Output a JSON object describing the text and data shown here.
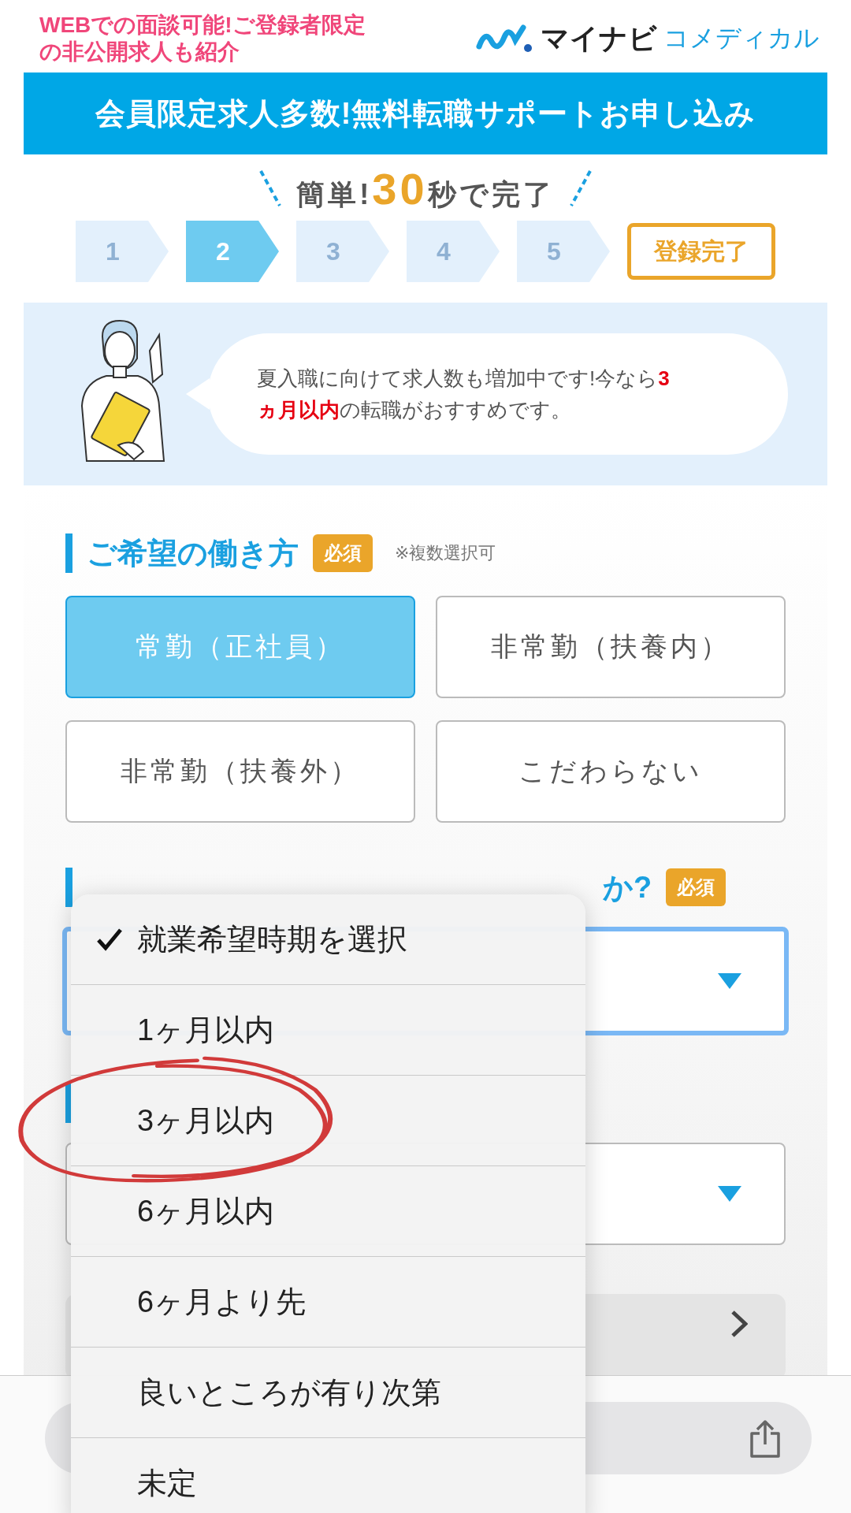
{
  "header": {
    "tagline_lines": [
      "WEBでの面談可能!ご登録者限定",
      "の非公開求人も紹介"
    ],
    "logo_main": "マイナビ",
    "logo_sub": "コメディカル"
  },
  "banner": "会員限定求人多数!無料転職サポートお申し込み",
  "speed_note": "簡単!**30**秒で完了",
  "steps": [
    {
      "label": "1",
      "kind": "step",
      "selected": false
    },
    {
      "label": "2",
      "kind": "step",
      "selected": true
    },
    {
      "label": "3",
      "kind": "step",
      "selected": false
    },
    {
      "label": "4",
      "kind": "step",
      "selected": false
    },
    {
      "label": "5",
      "kind": "step",
      "selected": false
    },
    {
      "label": "登録完了",
      "kind": "goal",
      "selected": false
    }
  ],
  "message_lines": [
    "夏入職に向けて求人数も増加中です!今なら**3**",
    "**ヵ月以内**の転職がおすすめです。"
  ],
  "work_style": {
    "title": "ご希望の働き方",
    "required": "必須",
    "note": "※複数選択可",
    "options": [
      {
        "label": "常勤（正社員）",
        "selected": true
      },
      {
        "label": "非常勤（扶養内）",
        "selected": false
      },
      {
        "label": "非常勤（扶養外）",
        "selected": false
      },
      {
        "label": "こだわらない",
        "selected": false
      }
    ]
  },
  "timing": {
    "title_visible": "か?",
    "required": "必須",
    "select": {
      "focused": true
    }
  },
  "next_section": {
    "select": {
      "focused": false
    }
  },
  "picker": {
    "items": [
      {
        "label": "就業希望時期を選択",
        "selected": true,
        "circled": false
      },
      {
        "label": "1ヶ月以内",
        "selected": false,
        "circled": false
      },
      {
        "label": "3ヶ月以内",
        "selected": false,
        "circled": true
      },
      {
        "label": "6ヶ月以内",
        "selected": false,
        "circled": false
      },
      {
        "label": "6ヶ月より先",
        "selected": false,
        "circled": false
      },
      {
        "label": "良いところが有り次第",
        "selected": false,
        "circled": false
      },
      {
        "label": "未定",
        "selected": false,
        "circled": false
      }
    ]
  }
}
